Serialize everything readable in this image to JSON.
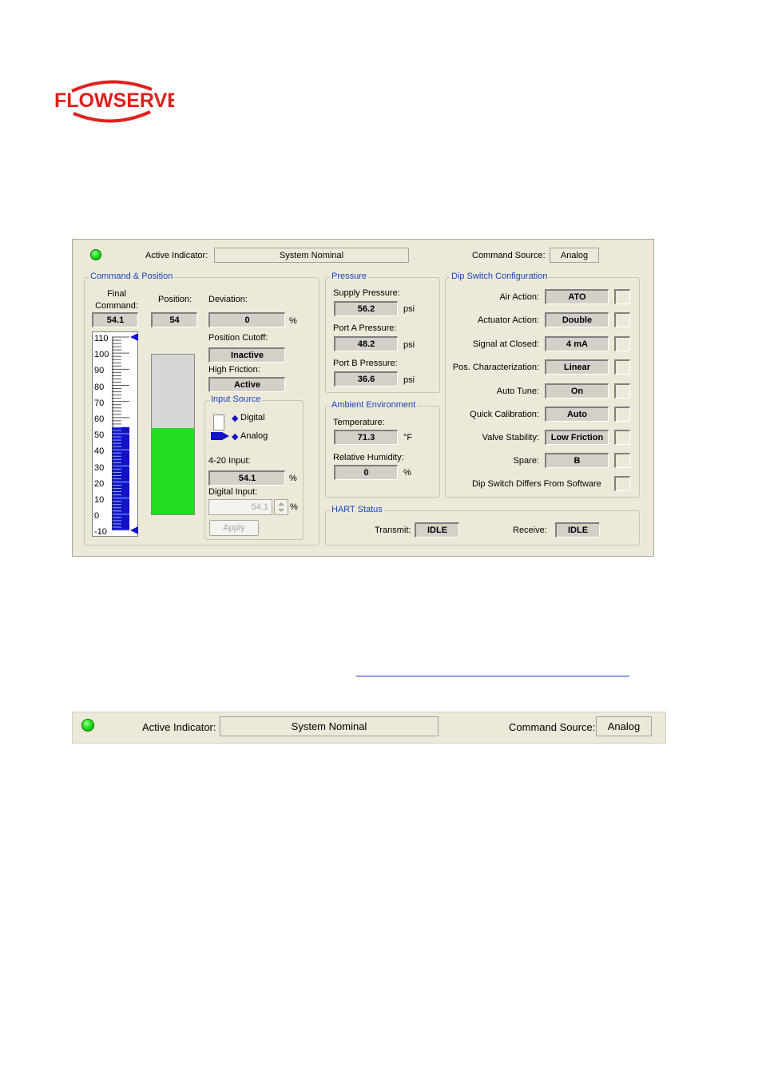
{
  "brand": {
    "name": "FLOWSERVE",
    "color": "#e0201b"
  },
  "header": {
    "active_indicator_label": "Active Indicator:",
    "active_indicator_value": "System Nominal",
    "command_source_label": "Command Source:",
    "command_source_value": "Analog",
    "led_color": "#1fe01f"
  },
  "command_position": {
    "title": "Command & Position",
    "final_command_label": "Final\nCommand:",
    "final_command_value": "54.1",
    "position_label": "Position:",
    "position_value": "54",
    "deviation_label": "Deviation:",
    "deviation_value": "0",
    "deviation_unit": "%",
    "position_cutoff_label": "Position Cutoff:",
    "position_cutoff_value": "Inactive",
    "high_friction_label": "High Friction:",
    "high_friction_value": "Active",
    "scale_ticks": [
      "110",
      "100",
      "90",
      "80",
      "70",
      "60",
      "50",
      "40",
      "30",
      "20",
      "10",
      "0",
      "-10"
    ],
    "command_level": 54.1,
    "position_level": 54,
    "bar_color": "#1212c8",
    "position_fill_color": "#22dd22"
  },
  "input_source": {
    "title": "Input Source",
    "options": [
      "Digital",
      "Analog"
    ],
    "selected": "Analog",
    "input_4_20_label": "4-20 Input:",
    "input_4_20_value": "54.1",
    "input_unit": "%",
    "digital_input_label": "Digital Input:",
    "digital_input_value": "54.1",
    "digital_unit": "%",
    "apply_label": "Apply"
  },
  "pressure": {
    "title": "Pressure",
    "items": [
      {
        "label": "Supply Pressure:",
        "value": "56.2",
        "unit": "psi"
      },
      {
        "label": "Port A Pressure:",
        "value": "48.2",
        "unit": "psi"
      },
      {
        "label": "Port B Pressure:",
        "value": "36.6",
        "unit": "psi"
      }
    ]
  },
  "ambient": {
    "title": "Ambient Environment",
    "temperature_label": "Temperature:",
    "temperature_value": "71.3",
    "temperature_unit": "°F",
    "humidity_label": "Relative Humidity:",
    "humidity_value": "0",
    "humidity_unit": "%"
  },
  "dip_switch": {
    "title": "Dip Switch Configuration",
    "items": [
      {
        "label": "Air Action:",
        "value": "ATO"
      },
      {
        "label": "Actuator Action:",
        "value": "Double"
      },
      {
        "label": "Signal at Closed:",
        "value": "4 mA"
      },
      {
        "label": "Pos. Characterization:",
        "value": "Linear"
      },
      {
        "label": "Auto Tune:",
        "value": "On"
      },
      {
        "label": "Quick Calibration:",
        "value": "Auto"
      },
      {
        "label": "Valve Stability:",
        "value": "Low Friction"
      },
      {
        "label": "Spare:",
        "value": "B"
      }
    ],
    "differs_label": "Dip Switch Differs From Software"
  },
  "hart": {
    "title": "HART Status",
    "transmit_label": "Transmit:",
    "transmit_value": "IDLE",
    "receive_label": "Receive:",
    "receive_value": "IDLE"
  },
  "strip": {
    "active_indicator_label": "Active Indicator:",
    "active_indicator_value": "System Nominal",
    "command_source_label": "Command Source:",
    "command_source_value": "Analog"
  }
}
